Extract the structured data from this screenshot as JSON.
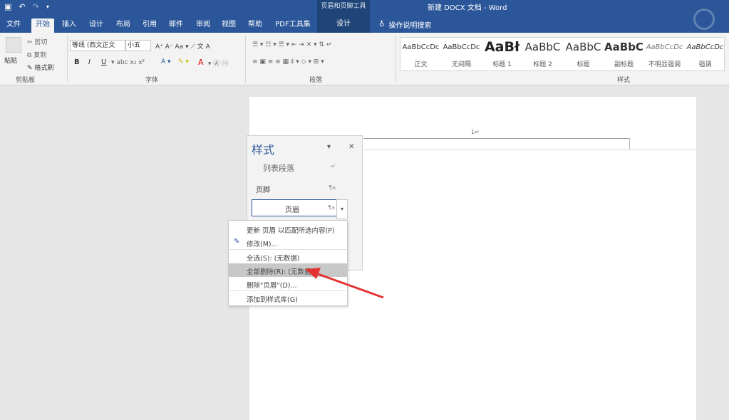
{
  "window": {
    "title": "新建 DOCX 文档 - Word",
    "context_tool_group": "页眉和页脚工具"
  },
  "tabs": [
    {
      "label": "文件"
    },
    {
      "label": "开始"
    },
    {
      "label": "插入"
    },
    {
      "label": "设计"
    },
    {
      "label": "布局"
    },
    {
      "label": "引用"
    },
    {
      "label": "邮件"
    },
    {
      "label": "审阅"
    },
    {
      "label": "视图"
    },
    {
      "label": "帮助"
    },
    {
      "label": "PDF工具集"
    },
    {
      "label": "设计"
    }
  ],
  "tell_me": "操作说明搜索",
  "clipboard": {
    "paste": "粘贴",
    "cut": "剪切",
    "copy": "复制",
    "format_painter": "格式刷",
    "label": "剪贴板"
  },
  "font": {
    "name": "等线 (西文正文",
    "size": "小五",
    "label": "字体"
  },
  "paragraph": {
    "label": "段落"
  },
  "styles_group": {
    "label": "样式",
    "items": [
      {
        "sample": "AaBbCcDc",
        "name": "正文"
      },
      {
        "sample": "AaBbCcDc",
        "name": "无间隔"
      },
      {
        "sample": "AaBł",
        "name": "标题 1"
      },
      {
        "sample": "AaBbC",
        "name": "标题 2"
      },
      {
        "sample": "AaBbC",
        "name": "标题"
      },
      {
        "sample": "AaBbC",
        "name": "副标题"
      },
      {
        "sample": "AaBbCcDc",
        "name": "不明显强调"
      },
      {
        "sample": "AaBbCcDc",
        "name": "强调"
      }
    ]
  },
  "document": {
    "page_number": "1↵"
  },
  "styles_pane": {
    "title": "样式",
    "items": [
      {
        "label": "列表段落",
        "mark": "↵"
      },
      {
        "label": "页脚",
        "mark": "¶a"
      },
      {
        "label": "页眉",
        "mark": "¶a"
      }
    ]
  },
  "context_menu": {
    "items": [
      {
        "label": "更新 页眉 以匹配所选内容(P)"
      },
      {
        "label": "修改(M)..."
      },
      {
        "label": "全选(S): (无数据)"
      },
      {
        "label": "全部删除(R): (无数据)"
      },
      {
        "label": "删除\"页眉\"(D)..."
      },
      {
        "label": "添加到样式库(G)"
      }
    ]
  },
  "colors": {
    "accent": "#2b579a",
    "arrow": "#e53333"
  }
}
